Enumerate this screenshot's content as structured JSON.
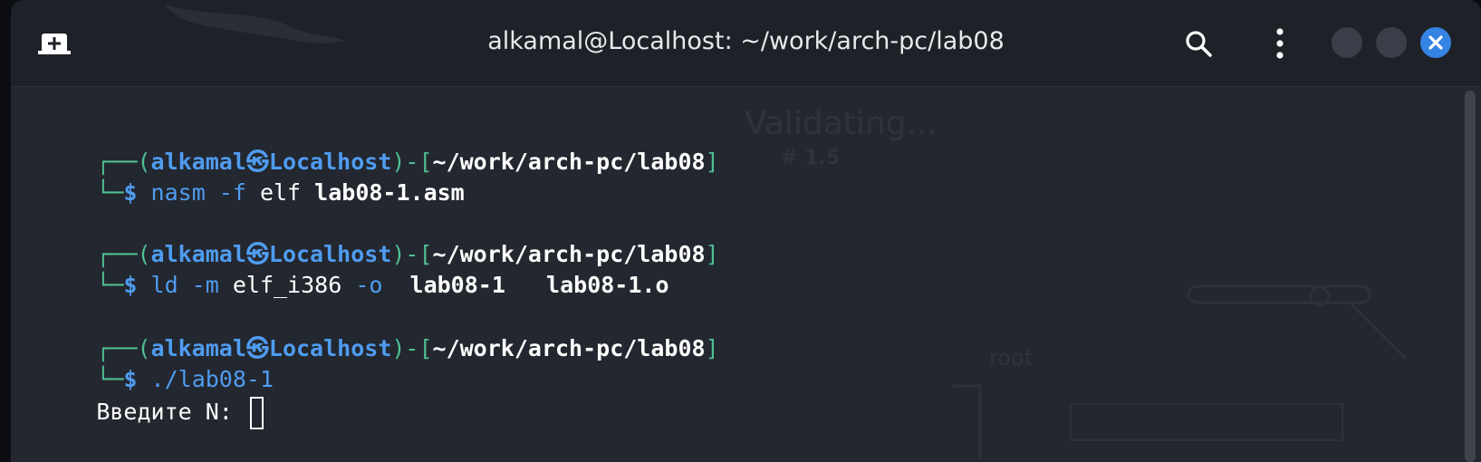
{
  "window": {
    "title": "alkamal@Localhost: ~/work/arch-pc/lab08"
  },
  "toolbar": {
    "new_tab_icon": "new-tab-icon",
    "search_icon": "search-icon",
    "menu_icon": "kebab-menu-icon",
    "minimize_icon": "minimize-icon",
    "maximize_icon": "maximize-icon",
    "close_icon": "close-icon"
  },
  "background_watermark": {
    "title": "Validating...",
    "version": "# 1.5",
    "label": "root"
  },
  "prompt": {
    "open": "┌──(",
    "user": "alkamal",
    "at_symbol": "㉿",
    "host": "Localhost",
    "mid": ")-[",
    "path": "~/work/arch-pc/lab08",
    "close": "]",
    "dollar_prefix": "└─",
    "dollar": "$"
  },
  "commands": [
    {
      "tokens": [
        {
          "text": " nasm",
          "style": "c"
        },
        {
          "text": " -f",
          "style": "c"
        },
        {
          "text": " elf ",
          "style": "t"
        },
        {
          "text": "lab08-1.asm",
          "style": "w"
        }
      ]
    },
    {
      "tokens": [
        {
          "text": " ld",
          "style": "c"
        },
        {
          "text": " -m",
          "style": "c"
        },
        {
          "text": " elf_i386 ",
          "style": "t"
        },
        {
          "text": "-o",
          "style": "c"
        },
        {
          "text": "  lab08-1   lab08-1.o",
          "style": "w"
        }
      ]
    },
    {
      "tokens": [
        {
          "text": " ./lab08-1",
          "style": "c"
        }
      ]
    }
  ],
  "output": {
    "prompt_text": "Введите N: "
  },
  "colors": {
    "green": "#4fbf93",
    "blue": "#4f9cf0",
    "close_button": "#3584e4",
    "background": "#23272f"
  }
}
